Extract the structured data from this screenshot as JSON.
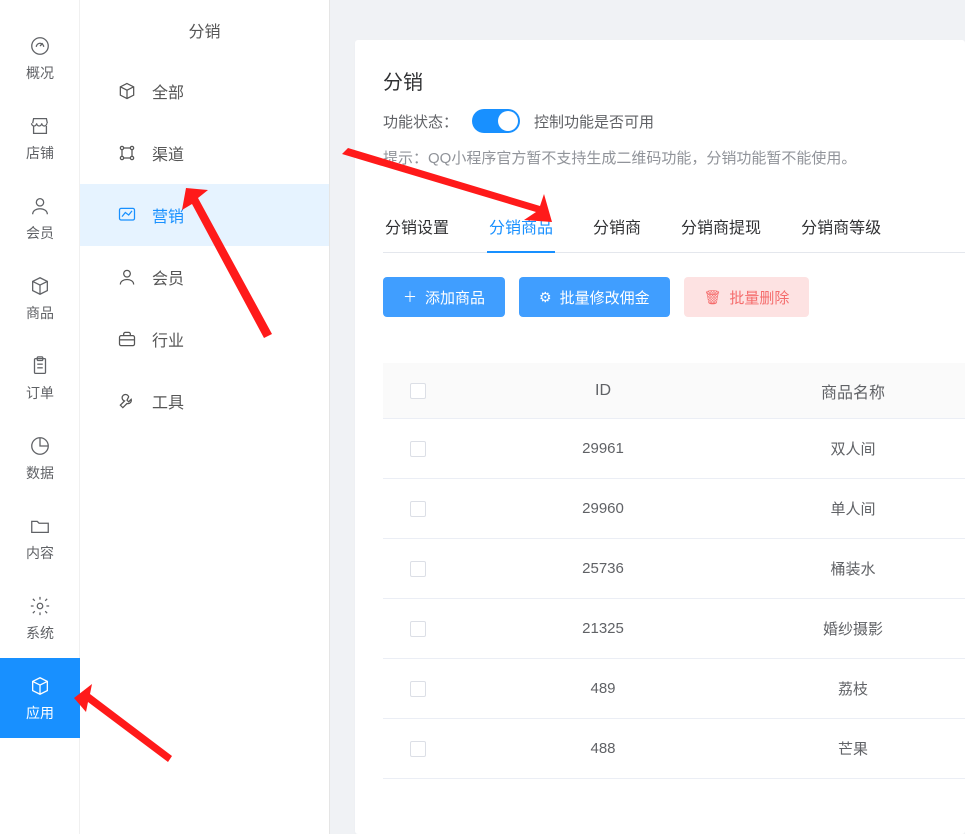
{
  "sidebar_primary": {
    "items": [
      {
        "name": "overview",
        "label": "概况"
      },
      {
        "name": "shop",
        "label": "店铺"
      },
      {
        "name": "member",
        "label": "会员"
      },
      {
        "name": "goods",
        "label": "商品"
      },
      {
        "name": "order",
        "label": "订单"
      },
      {
        "name": "data",
        "label": "数据"
      },
      {
        "name": "content",
        "label": "内容"
      },
      {
        "name": "system",
        "label": "系统"
      },
      {
        "name": "apps",
        "label": "应用"
      }
    ],
    "active": "apps"
  },
  "sidebar_secondary": {
    "title": "分销",
    "items": [
      {
        "name": "all",
        "label": "全部"
      },
      {
        "name": "channel",
        "label": "渠道"
      },
      {
        "name": "marketing",
        "label": "营销"
      },
      {
        "name": "member",
        "label": "会员"
      },
      {
        "name": "industry",
        "label": "行业"
      },
      {
        "name": "tools",
        "label": "工具"
      }
    ],
    "active": "marketing"
  },
  "page": {
    "title": "分销",
    "status_label": "功能状态：",
    "status_hint": "控制功能是否可用",
    "tip_label": "提示：",
    "tip_text": "QQ小程序官方暂不支持生成二维码功能，分销功能暂不能使用。",
    "switch_on": true
  },
  "tabs": {
    "items": [
      {
        "name": "settings",
        "label": "分销设置"
      },
      {
        "name": "goods",
        "label": "分销商品"
      },
      {
        "name": "distributors",
        "label": "分销商"
      },
      {
        "name": "withdraw",
        "label": "分销商提现"
      },
      {
        "name": "levels",
        "label": "分销商等级"
      }
    ],
    "active": "goods"
  },
  "buttons": {
    "add": "添加商品",
    "bulk_commission": "批量修改佣金",
    "bulk_delete": "批量删除"
  },
  "table": {
    "headers": {
      "id": "ID",
      "name": "商品名称"
    },
    "rows": [
      {
        "id": "29961",
        "name": "双人间"
      },
      {
        "id": "29960",
        "name": "单人间"
      },
      {
        "id": "25736",
        "name": "桶装水"
      },
      {
        "id": "21325",
        "name": "婚纱摄影"
      },
      {
        "id": "489",
        "name": "荔枝"
      },
      {
        "id": "488",
        "name": "芒果"
      }
    ]
  }
}
